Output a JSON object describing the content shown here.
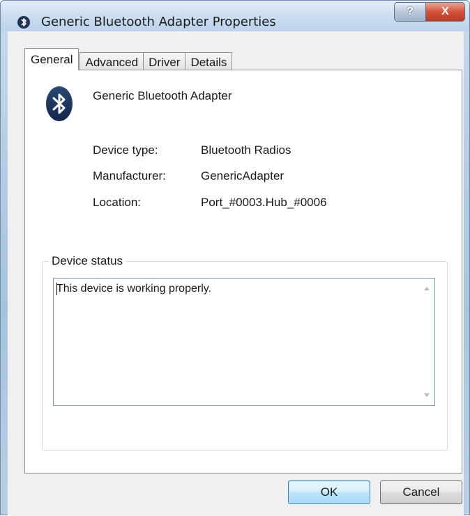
{
  "window": {
    "title": "Generic Bluetooth Adapter Properties",
    "help_label": "?",
    "close_label": "X"
  },
  "tabs": [
    {
      "label": "General",
      "active": true
    },
    {
      "label": "Advanced",
      "active": false
    },
    {
      "label": "Driver",
      "active": false
    },
    {
      "label": "Details",
      "active": false
    }
  ],
  "device": {
    "name": "Generic Bluetooth Adapter",
    "icon": "bluetooth-icon",
    "properties": [
      {
        "label": "Device type:",
        "value": "Bluetooth Radios"
      },
      {
        "label": "Manufacturer:",
        "value": "GenericAdapter"
      },
      {
        "label": "Location:",
        "value": "Port_#0003.Hub_#0006"
      }
    ]
  },
  "status": {
    "group_title": "Device status",
    "text": "This device is working properly."
  },
  "buttons": {
    "ok": "OK",
    "cancel": "Cancel"
  },
  "colors": {
    "bluetooth_icon": "#1f3557",
    "close_button": "#d3543a"
  }
}
